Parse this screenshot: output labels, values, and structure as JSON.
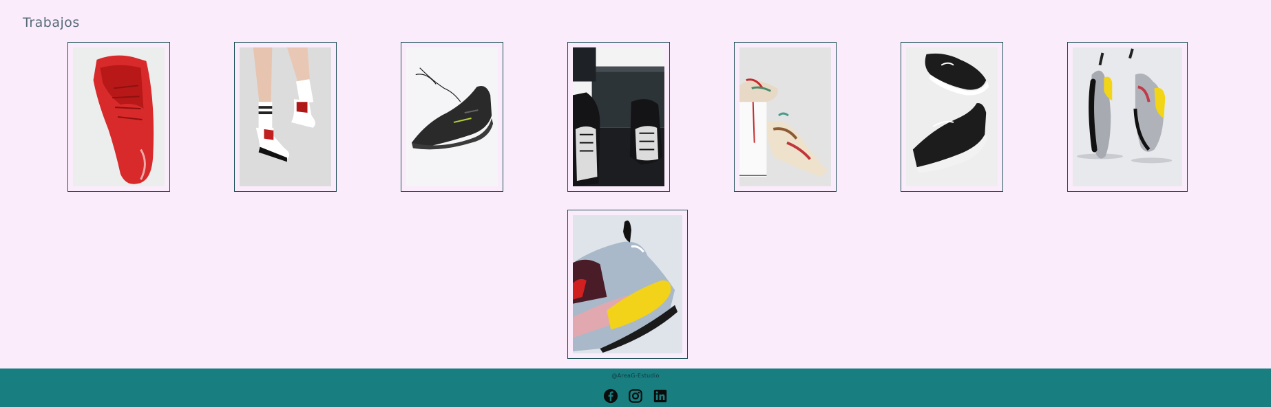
{
  "page": {
    "section_title": "Trabajos"
  },
  "gallery": {
    "items": [
      {
        "name": "red-high-top-sneaker"
      },
      {
        "name": "red-white-black-sneakers-legs"
      },
      {
        "name": "black-running-shoe-floating"
      },
      {
        "name": "black-checkered-sneakers-feet"
      },
      {
        "name": "colorful-sneakers-on-cubes"
      },
      {
        "name": "black-white-trainers-pair"
      },
      {
        "name": "grey-yellow-sneakers-floating"
      },
      {
        "name": "yellow-sole-sneaker-closeup"
      }
    ]
  },
  "footer": {
    "credit": "@AreaG-Estudio",
    "social_icons": [
      "facebook-icon",
      "instagram-icon",
      "linkedin-icon"
    ]
  },
  "colors": {
    "background": "#fbecfb",
    "footer": "#187e80",
    "card_border": "#1a4f55",
    "title": "#556a78"
  }
}
